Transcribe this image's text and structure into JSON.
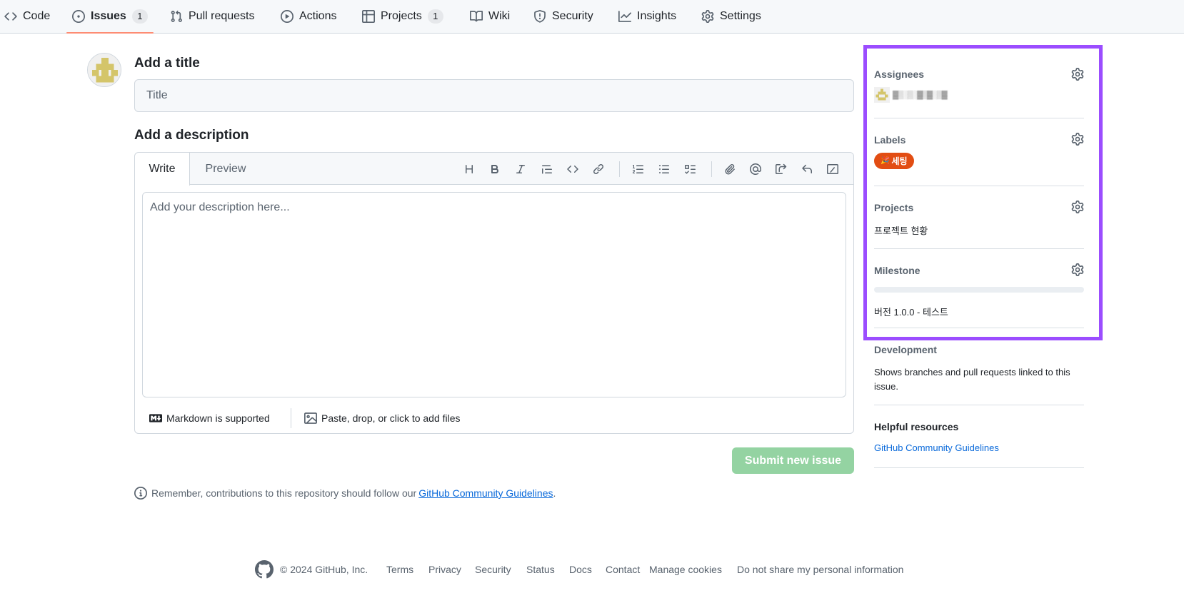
{
  "nav": {
    "code": "Code",
    "issues": "Issues",
    "issues_count": "1",
    "pull_requests": "Pull requests",
    "actions": "Actions",
    "projects": "Projects",
    "projects_count": "1",
    "wiki": "Wiki",
    "security": "Security",
    "insights": "Insights",
    "settings": "Settings"
  },
  "form": {
    "title_heading": "Add a title",
    "title_placeholder": "Title",
    "description_heading": "Add a description",
    "tab_write": "Write",
    "tab_preview": "Preview",
    "description_placeholder": "Add your description here...",
    "markdown_note": "Markdown is supported",
    "files_note": "Paste, drop, or click to add files",
    "submit_label": "Submit new issue",
    "remember_text": "Remember, contributions to this repository should follow our",
    "remember_link": "GitHub Community Guidelines",
    "remember_period": "."
  },
  "toolbar": {
    "icons": [
      "heading-icon",
      "bold-icon",
      "italic-icon",
      "quote-icon",
      "code-icon",
      "link-icon",
      "ordered-list-icon",
      "unordered-list-icon",
      "task-list-icon",
      "attach-icon",
      "mention-icon",
      "reference-icon",
      "reply-icon",
      "slash-command-icon"
    ]
  },
  "sidebar": {
    "assignees_heading": "Assignees",
    "assignee_name": "▓▒░▒░▓▒▓░▒▓",
    "labels_heading": "Labels",
    "label_text": "세팅",
    "label_emoji": "🎉",
    "label_color": "#e24d13",
    "projects_heading": "Projects",
    "project_name": "프로젝트 현황",
    "milestone_heading": "Milestone",
    "milestone_progress": 0,
    "milestone_name": "버전 1.0.0 - 테스트",
    "development_heading": "Development",
    "development_text": "Shows branches and pull requests linked to this issue.",
    "resources_heading": "Helpful resources",
    "resources_link": "GitHub Community Guidelines"
  },
  "footer": {
    "copyright": "© 2024 GitHub, Inc.",
    "terms": "Terms",
    "privacy": "Privacy",
    "security": "Security",
    "status": "Status",
    "docs": "Docs",
    "contact": "Contact",
    "manage_cookies": "Manage cookies",
    "do_not_share": "Do not share my personal information"
  },
  "colors": {
    "accent_underline": "#fd8c73",
    "submit_disabled": "#94d3a2",
    "link": "#0969da",
    "highlight": "#9b4dff"
  }
}
